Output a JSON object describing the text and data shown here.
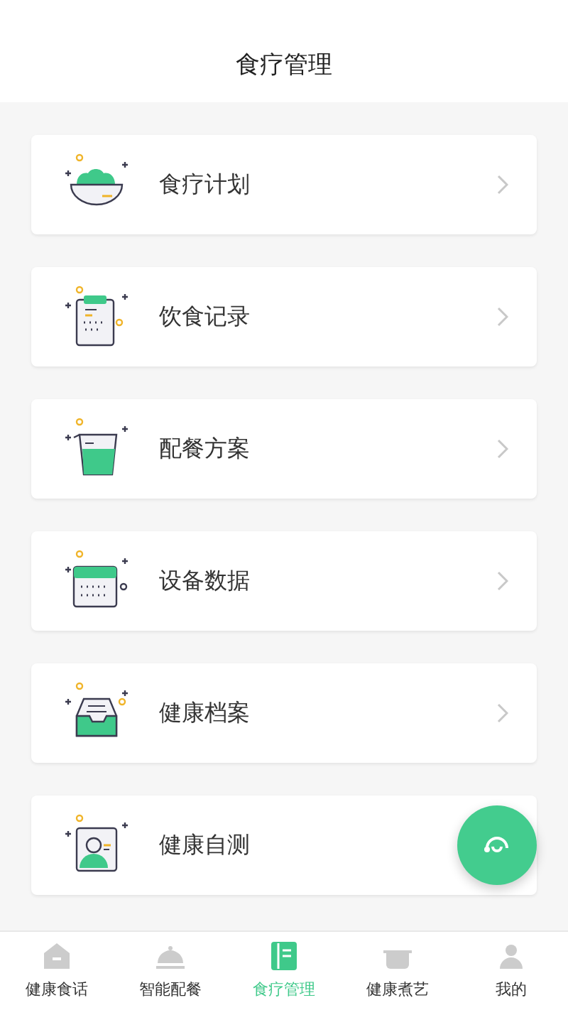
{
  "header": {
    "title": "食疗管理"
  },
  "menu": [
    {
      "label": "食疗计划"
    },
    {
      "label": "饮食记录"
    },
    {
      "label": "配餐方案"
    },
    {
      "label": "设备数据"
    },
    {
      "label": "健康档案"
    },
    {
      "label": "健康自测"
    }
  ],
  "tabs": [
    {
      "label": "健康食话",
      "selected": false
    },
    {
      "label": "智能配餐",
      "selected": false
    },
    {
      "label": "食疗管理",
      "selected": true
    },
    {
      "label": "健康煮艺",
      "selected": false
    },
    {
      "label": "我的",
      "selected": false
    }
  ]
}
